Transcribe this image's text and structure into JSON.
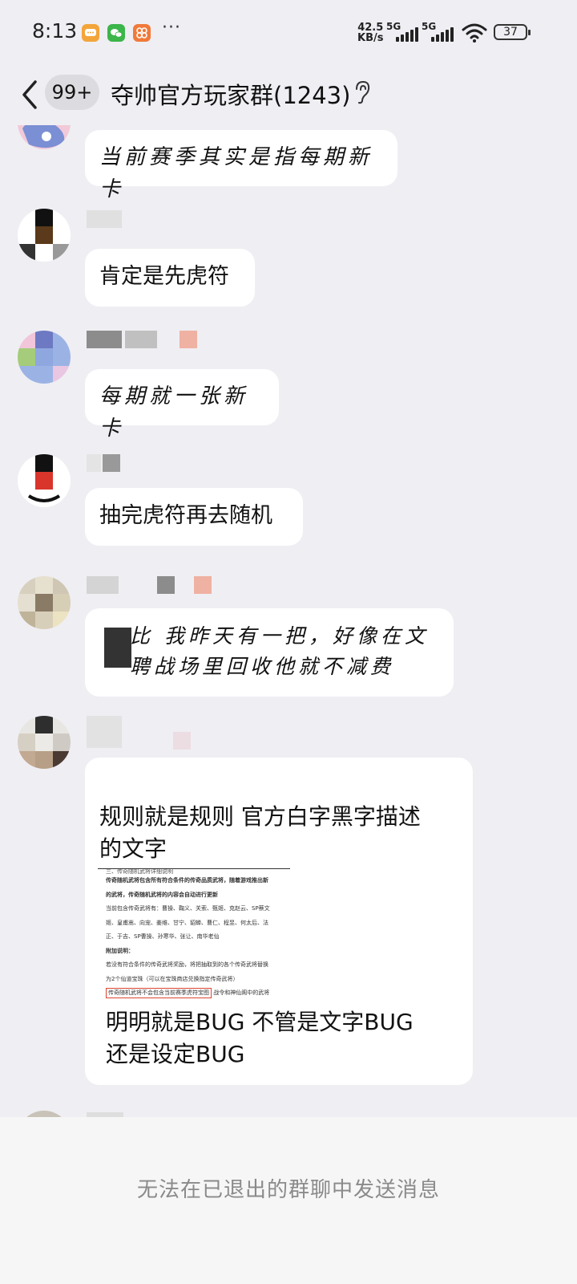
{
  "status_bar": {
    "time": "8:13",
    "net_speed_value": "42.5",
    "net_speed_unit": "KB/s",
    "sim1_label": "5G",
    "sim2_label": "5G",
    "battery": "37",
    "notification_icons": [
      "message-app-icon",
      "wechat-icon",
      "game-app-icon"
    ],
    "more_indicator": "···"
  },
  "header": {
    "back_icon": "chevron-left-icon",
    "unread_badge": "99+",
    "title": "夺帅官方玩家群(1243)",
    "title_icon": "ear-icon"
  },
  "messages": [
    {
      "text": "当前赛季其实是指每期新卡"
    },
    {
      "text": "肯定是先虎符"
    },
    {
      "text": "每期就一张新卡"
    },
    {
      "text": "抽完虎符再去随机"
    },
    {
      "text": "比 我昨天有一把，好像在文\n聘战场里回收他就不减费"
    },
    {
      "text_before": "规则就是规则  官方白字黑字描述\n的文字",
      "text_after": "明明就是BUG  不管是文字BUG\n还是设定BUG",
      "embedded_doc": {
        "heading": "三、传奇随机武将详细说明",
        "line1": "传奇随机武将包含所有符合条件的传奇品质武将，随着游戏推出新",
        "line2": "的武将，传奇随机武将的内容会自动进行更新",
        "line3": "当前包含传奇武将有：曹操、鞠义、关索、甄姬、克赵云、SP蔡文",
        "line4": "姬、皇甫嵩、向宠、姜维、甘宁、貂蝉、曹仁、程昱、何太后、法",
        "line5": "正、于吉、SP曹操、孙寒华、张让、南华老仙",
        "line6": "附加说明：",
        "line7": "若没有符合条件的传奇武将奖励，将把抽取到的各个传奇武将替换",
        "line8": "为2个仙道宝珠（可以在宝珠商店兑换指定传奇武将）",
        "line9_highlight": "传奇随机武将不会包含当前赛季虎符宝图",
        "line9_rest": "战令和神仙阁中的武将"
      }
    }
  ],
  "footer": {
    "notice": "无法在已退出的群聊中发送消息"
  }
}
